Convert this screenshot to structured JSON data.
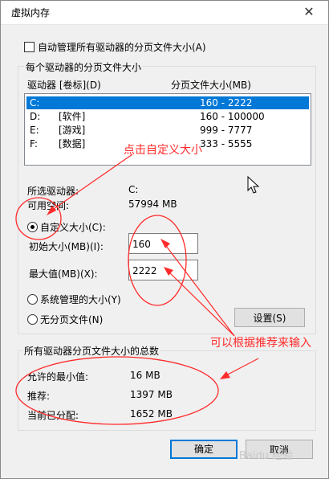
{
  "window": {
    "title": "虚拟内存",
    "close_glyph": "✕"
  },
  "auto_manage": {
    "label": "自动管理所有驱动器的分页文件大小(A)",
    "checked": false
  },
  "per_drive_group": {
    "legend": "每个驱动器的分页文件大小",
    "columns": [
      "驱动器 [卷标](D)",
      "分页文件大小(MB)"
    ],
    "rows": [
      {
        "drive": "C:",
        "label": "",
        "size": "160 - 2222",
        "selected": true
      },
      {
        "drive": "D:",
        "label": "[软件]",
        "size": "160 - 100000",
        "selected": false
      },
      {
        "drive": "E:",
        "label": "[游戏]",
        "size": "999 - 7777",
        "selected": false
      },
      {
        "drive": "F:",
        "label": "[数据]",
        "size": "333 - 5555",
        "selected": false
      }
    ],
    "selected_drive_label": "所选驱动器:",
    "selected_drive_value": "C:",
    "free_space_label": "可用空间:",
    "free_space_value": "57994 MB",
    "custom_size_label": "自定义大小(C):",
    "initial_size_label": "初始大小(MB)(I):",
    "initial_size_value": "160",
    "max_size_label": "最大值(MB)(X):",
    "max_size_value": "2222",
    "system_managed_label": "系统管理的大小(Y)",
    "no_paging_label": "无分页文件(N)",
    "set_button": "设置(S)",
    "selected_option": "custom"
  },
  "total_group": {
    "legend": "所有驱动器分页文件大小的总数",
    "min_allowed_label": "允许的最小值:",
    "min_allowed_value": "16 MB",
    "recommended_label": "推荐:",
    "recommended_value": "1397 MB",
    "allocated_label": "当前已分配:",
    "allocated_value": "1652 MB"
  },
  "buttons": {
    "ok": "确定",
    "cancel": "取消"
  },
  "annotations": {
    "click_custom": "点击自定义大小",
    "input_hint": "可以根据推荐来输入",
    "color": "#ff2a2a"
  },
  "watermark": "Baidu 经验"
}
